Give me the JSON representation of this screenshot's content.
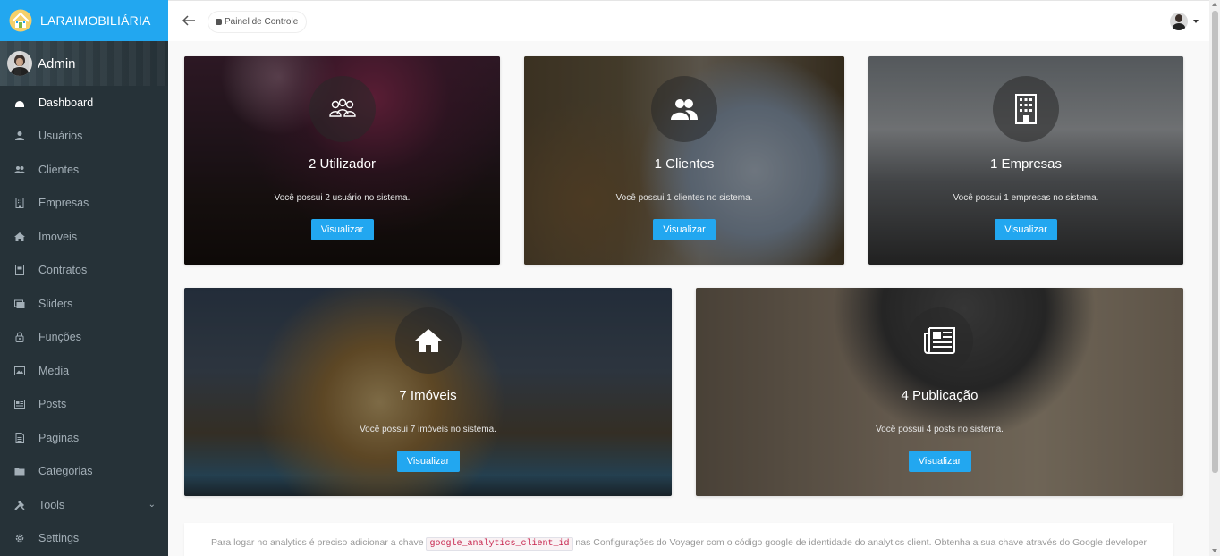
{
  "brand": {
    "title": "LARAIMOBILIÁRIA",
    "logo": "house-logo-icon"
  },
  "user": {
    "name": "Admin"
  },
  "sidebar": {
    "items": [
      {
        "label": "Dashboard",
        "icon": "dashboard-icon",
        "active": true
      },
      {
        "label": "Usuários",
        "icon": "person-icon"
      },
      {
        "label": "Clientes",
        "icon": "people-icon"
      },
      {
        "label": "Empresas",
        "icon": "building-icon"
      },
      {
        "label": "Imoveis",
        "icon": "home-icon"
      },
      {
        "label": "Contratos",
        "icon": "book-icon"
      },
      {
        "label": "Sliders",
        "icon": "images-icon"
      },
      {
        "label": "Funções",
        "icon": "lock-icon"
      },
      {
        "label": "Media",
        "icon": "image-icon"
      },
      {
        "label": "Posts",
        "icon": "news-icon"
      },
      {
        "label": "Paginas",
        "icon": "file-icon"
      },
      {
        "label": "Categorias",
        "icon": "folder-icon"
      },
      {
        "label": "Tools",
        "icon": "tools-icon"
      },
      {
        "label": "Settings",
        "icon": "gear-icon"
      }
    ]
  },
  "topbar": {
    "breadcrumb": "Painel de Controle"
  },
  "cards": [
    {
      "title": "2 Utilizador",
      "text": "Você possui 2 usuário no sistema.",
      "button": "Visualizar",
      "icon": "group-icon"
    },
    {
      "title": "1 Clientes",
      "text": "Você possui 1 clientes no sistema.",
      "button": "Visualizar",
      "icon": "people-icon"
    },
    {
      "title": "1 Empresas",
      "text": "Você possui 1 empresas no sistema.",
      "button": "Visualizar",
      "icon": "building-icon"
    },
    {
      "title": "7 Imóveis",
      "text": "Você possui 7 imóveis no sistema.",
      "button": "Visualizar",
      "icon": "home-icon"
    },
    {
      "title": "4 Publicação",
      "text": "Você possui 4 posts no sistema.",
      "button": "Visualizar",
      "icon": "news-icon"
    }
  ],
  "analytics": {
    "prefix": "Para logar no analytics é preciso adicionar a chave",
    "code": "google_analytics_client_id",
    "suffix": "nas Configurações do Voyager com o código google de identidade do analytics client. Obtenha a sua chave através do Google developer"
  },
  "colors": {
    "accent": "#22a7f0",
    "sidebar": "#263238"
  }
}
